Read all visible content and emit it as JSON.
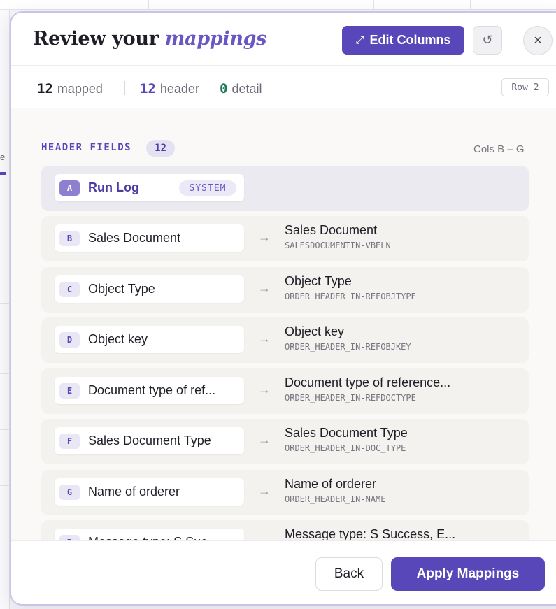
{
  "modal": {
    "title_plain": "Review your ",
    "title_accent": "mappings",
    "edit_columns_label": "Edit Columns",
    "stats": {
      "mapped_count": "12",
      "mapped_label": "mapped",
      "header_count": "12",
      "header_label": "header",
      "detail_count": "0",
      "detail_label": "detail"
    },
    "row_indicator": "Row 2",
    "section": {
      "title": "HEADER FIELDS",
      "count": "12",
      "cols_range": "Cols B – G"
    },
    "rows": [
      {
        "letter": "A",
        "source": "Run Log",
        "system_tag": "SYSTEM"
      },
      {
        "letter": "B",
        "source": "Sales Document",
        "target": "Sales Document",
        "code": "SALESDOCUMENTIN-VBELN"
      },
      {
        "letter": "C",
        "source": "Object Type",
        "target": "Object Type",
        "code": "ORDER_HEADER_IN-REFOBJTYPE"
      },
      {
        "letter": "D",
        "source": "Object key",
        "target": "Object key",
        "code": "ORDER_HEADER_IN-REFOBJKEY"
      },
      {
        "letter": "E",
        "source": "Document type of ref...",
        "target": "Document type of reference...",
        "code": "ORDER_HEADER_IN-REFDOCTYPE"
      },
      {
        "letter": "F",
        "source": "Sales Document Type",
        "target": "Sales Document Type",
        "code": "ORDER_HEADER_IN-DOC_TYPE"
      },
      {
        "letter": "G",
        "source": "Name of orderer",
        "target": "Name of orderer",
        "code": "ORDER_HEADER_IN-NAME"
      },
      {
        "letter": "B",
        "source": "Message type: S Suc...",
        "target": "Message type: S Success, E...",
        "code": ""
      }
    ],
    "arrow_glyph": "→",
    "back_label": "Back",
    "apply_label": "Apply Mappings"
  },
  "background": {
    "left_letter": "e"
  },
  "icons": {
    "edit": "expand-arrows-icon",
    "reset": "undo-icon",
    "close": "close-icon",
    "arrow": "right-arrow-icon"
  },
  "colors": {
    "accent": "#5847b8",
    "accent_text": "#6a57c4",
    "detail_green": "#1d7a5a",
    "modal_bg": "#faf9f7",
    "row_bg": "#f3f2ef"
  }
}
